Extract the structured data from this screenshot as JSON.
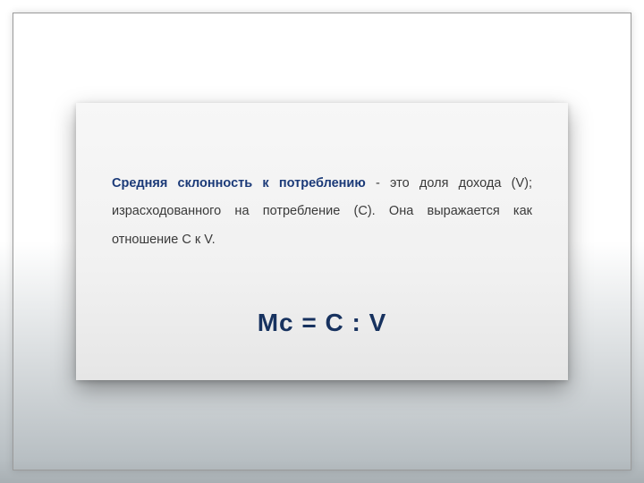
{
  "content": {
    "term": "Средняя склонность к потреблению",
    "definition_rest": " - это доля дохода (V); израсходованного на потребление (C). Она выражается как отношение C к V.",
    "formula": "Mc = C : V"
  }
}
